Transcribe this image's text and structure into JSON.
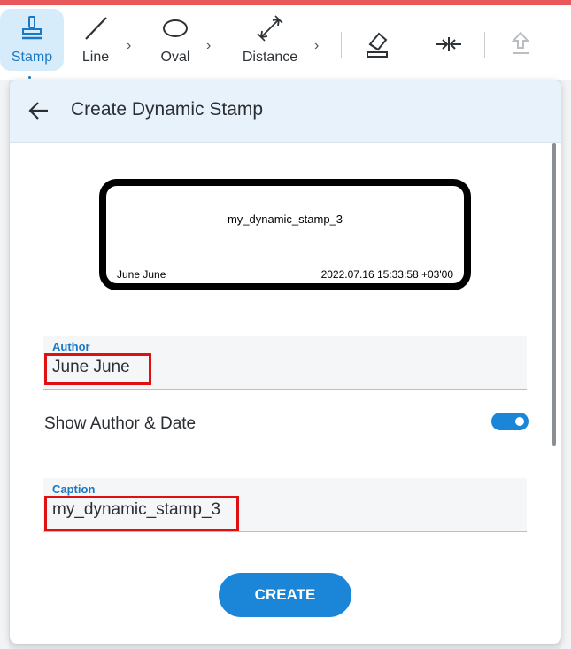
{
  "toolbar": {
    "tools": [
      {
        "label": "Stamp",
        "icon": "stamp-icon"
      },
      {
        "label": "Line",
        "icon": "line-icon"
      },
      {
        "label": "Oval",
        "icon": "oval-icon"
      },
      {
        "label": "Distance",
        "icon": "distance-icon"
      }
    ],
    "right_icons": [
      "eraser-icon",
      "collapse-icon",
      "upload-icon"
    ]
  },
  "panel": {
    "title": "Create Dynamic Stamp",
    "preview": {
      "caption": "my_dynamic_stamp_3",
      "author": "June June",
      "date": "2022.07.16 15:33:58 +03'00"
    },
    "author_field": {
      "label": "Author",
      "value": "June June"
    },
    "toggle": {
      "label": "Show Author & Date",
      "on": true
    },
    "caption_field": {
      "label": "Caption",
      "value": "my_dynamic_stamp_3"
    },
    "create_label": "CREATE"
  },
  "colors": {
    "accent": "#1b86d8",
    "highlight": "#e01010",
    "stripe": "#e8575a"
  }
}
